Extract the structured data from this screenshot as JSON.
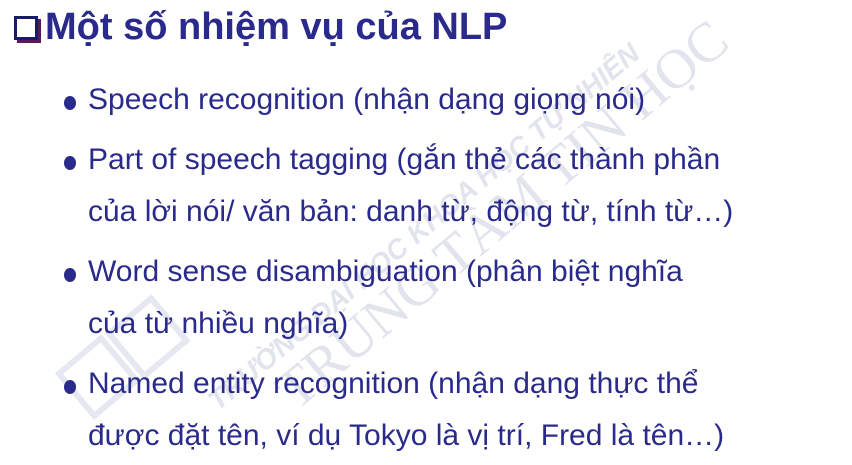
{
  "title": "Một số nhiệm vụ của NLP",
  "title_bullet_icon": "square-checkbox-icon",
  "text_color": "#2a2a8c",
  "items": [
    {
      "lines": [
        "Speech recognition (nhận dạng giọng nói)"
      ]
    },
    {
      "lines": [
        "Part of speech tagging (gắn thẻ các thành phần",
        "của lời nói/ văn bản: danh từ, động từ, tính từ…)"
      ]
    },
    {
      "lines": [
        "Word sense disambiguation (phân biệt nghĩa",
        "của từ nhiều nghĩa)"
      ]
    },
    {
      "lines": [
        "Named entity recognition (nhận dạng thực thể",
        "được đặt tên, ví dụ Tokyo là vị trí, Fred là tên…)"
      ]
    }
  ],
  "watermark": {
    "line1": "TRƯỜNG ĐẠI HỌC KHOA HỌC TỰ NHIÊN",
    "line2": "TRUNG TÂM TIN HỌC",
    "logo": "TT TH"
  }
}
